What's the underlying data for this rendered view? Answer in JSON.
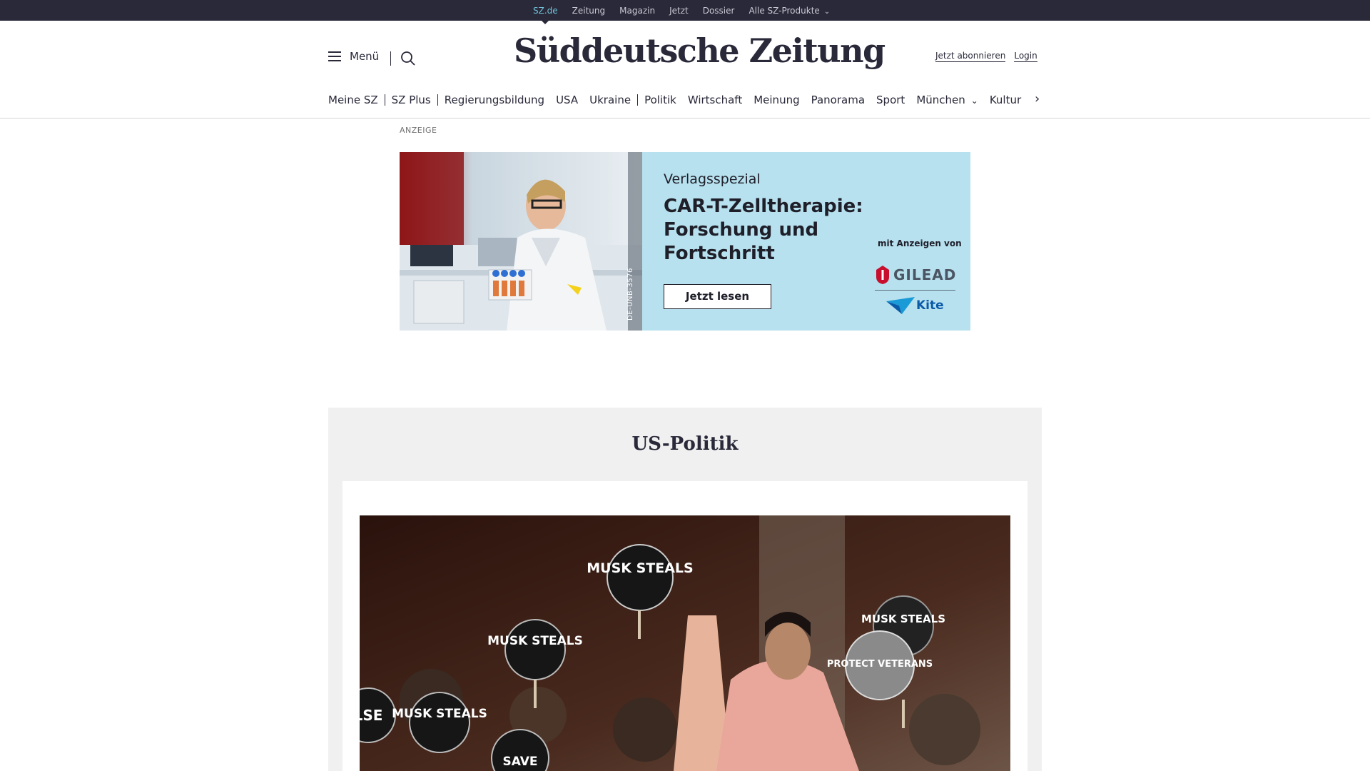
{
  "topbar": {
    "links": [
      "SZ.de",
      "Zeitung",
      "Magazin",
      "Jetzt",
      "Dossier",
      "Alle SZ-Produkte"
    ]
  },
  "header": {
    "menu_label": "Menü",
    "logo": "Süddeutsche Zeitung",
    "subscribe": "Jetzt abonnieren",
    "login": "Login"
  },
  "nav": {
    "items": [
      "Meine SZ",
      "SZ Plus",
      "Regierungsbildung",
      "USA",
      "Ukraine",
      "Politik",
      "Wirtschaft",
      "Meinung",
      "Panorama",
      "Sport",
      "München",
      "Kultur"
    ]
  },
  "ad": {
    "label": "ANZEIGE",
    "kicker": "Verlagsspezial",
    "headline": "CAR-T-Zelltherapie: Forschung und Fortschritt",
    "cta": "Jetzt lesen",
    "code": "DE-UNB-3576",
    "sponsor": "mit Anzeigen von",
    "logos": [
      "GILEAD",
      "Kite"
    ],
    "background": "#b7e1ee"
  },
  "section": {
    "title": "US-Politik",
    "image_signs": [
      "MUSK STEALS",
      "MUSK STEALS",
      "MUSK STEALS",
      "MUSK STEALS",
      "PROTECT VETERANS",
      "LSE",
      "SAVE"
    ]
  },
  "colors": {
    "topbar": "#29293a",
    "active_link": "#71c3d6",
    "section_bg": "#f0f0f0"
  }
}
